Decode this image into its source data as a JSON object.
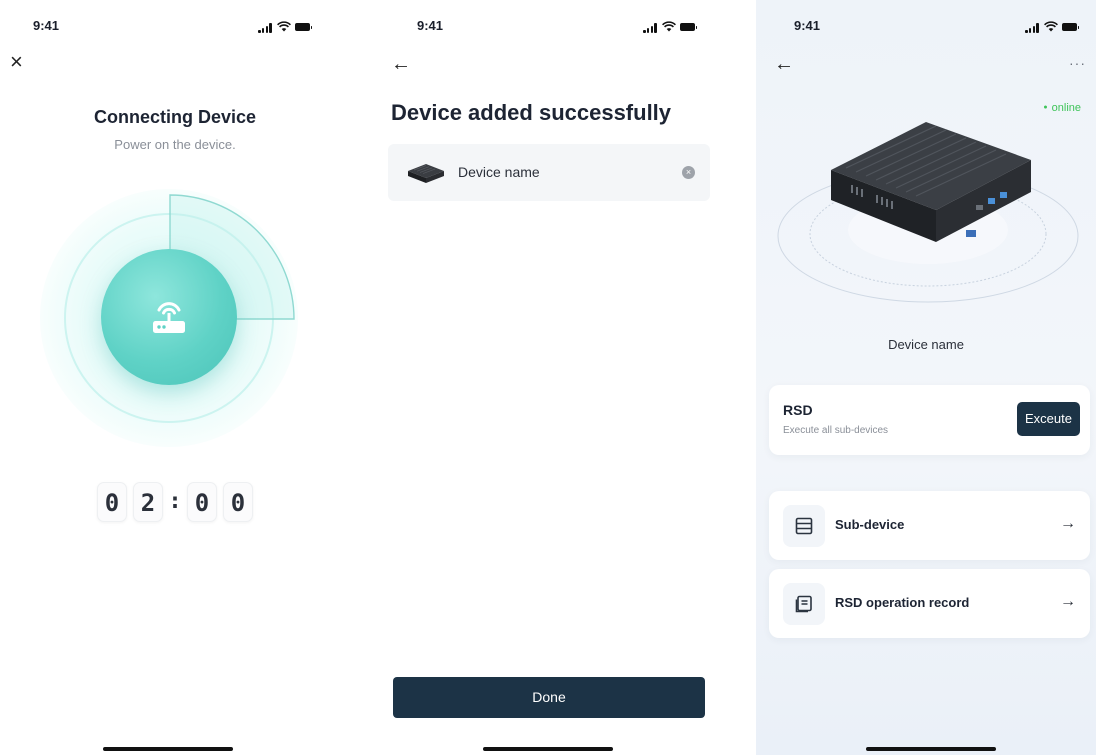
{
  "status_bar": {
    "time": "9:41"
  },
  "screen1": {
    "close_icon": "×",
    "title": "Connecting Device",
    "subtitle": "Power on the device.",
    "timer_digits": [
      "0",
      "2",
      "0",
      "0"
    ],
    "timer_separator": ":",
    "progress_fraction": 0.25,
    "accent": "#5fd2c6"
  },
  "screen2": {
    "back_icon": "←",
    "title": "Device added successfully",
    "device_name": "Device name",
    "clear_icon": "×",
    "done_label": "Done",
    "button_color": "#1c3346"
  },
  "screen3": {
    "back_icon": "←",
    "more_icon": "···",
    "status": "online",
    "status_color": "#3fc45a",
    "device_name": "Device name",
    "rsd": {
      "title": "RSD",
      "subtitle": "Execute all sub-devices",
      "button": "Exceute"
    },
    "menu": [
      {
        "label": "Sub-device",
        "icon": "server-rack-icon",
        "arrow": "→"
      },
      {
        "label": "RSD operation record",
        "icon": "record-list-icon",
        "arrow": "→"
      }
    ]
  }
}
